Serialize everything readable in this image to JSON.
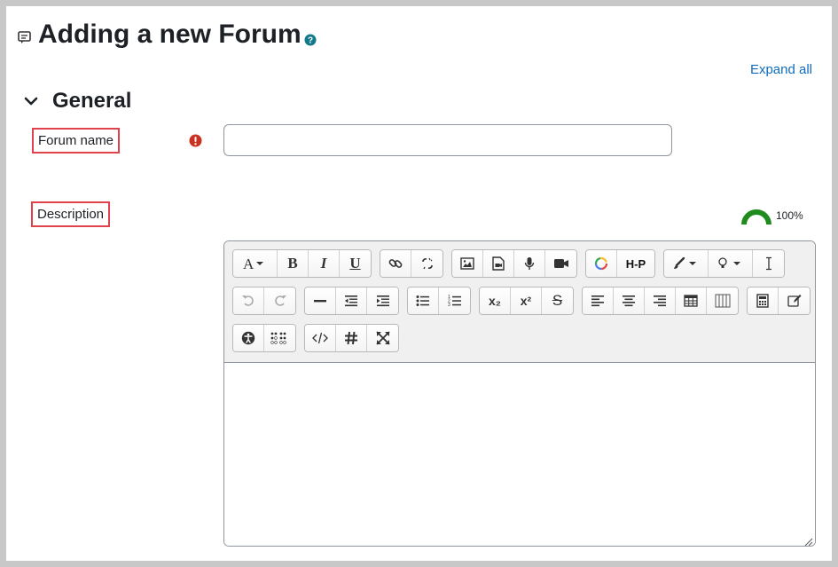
{
  "page": {
    "title": "Adding a new Forum",
    "expand_all": "Expand all"
  },
  "section": {
    "title": "General"
  },
  "fields": {
    "forum_name_label": "Forum name",
    "forum_name_value": "",
    "description_label": "Description"
  },
  "accessibility": {
    "score_text": "100%"
  },
  "colors": {
    "link": "#0f6cbf",
    "required": "#ca3120",
    "highlight_border": "#e0424b",
    "meter_green": "#1f8b1f"
  },
  "toolbar": {
    "row1": [
      [
        "font-style-icon",
        "bold-icon",
        "italic-icon",
        "underline-icon"
      ],
      [
        "link-icon",
        "unlink-icon"
      ],
      [
        "image-icon",
        "media-icon",
        "record-audio-icon",
        "record-video-icon"
      ],
      [
        "google-icon",
        "h5p-icon"
      ],
      [
        "paintbrush-icon",
        "lightbulb-icon",
        "text-cursor-icon"
      ]
    ],
    "row2": [
      [
        "undo-icon",
        "redo-icon"
      ],
      [
        "horizontal-rule-icon",
        "outdent-icon",
        "indent-icon"
      ],
      [
        "unordered-list-icon",
        "ordered-list-icon"
      ],
      [
        "subscript-icon",
        "superscript-icon",
        "strikethrough-icon"
      ],
      [
        "align-left-icon",
        "align-center-icon",
        "align-right-icon",
        "table-icon",
        "columns-icon"
      ],
      [
        "calculator-icon",
        "edit-icon"
      ]
    ],
    "row3": [
      [
        "accessibility-checker-icon",
        "braille-icon"
      ],
      [
        "html-source-icon",
        "hashtag-icon",
        "fullscreen-icon"
      ]
    ],
    "labels": {
      "bold": "B",
      "italic": "I",
      "underline": "U",
      "subscript": "x₂",
      "superscript": "x²",
      "strikethrough": "S",
      "h5p": "H-P"
    }
  }
}
